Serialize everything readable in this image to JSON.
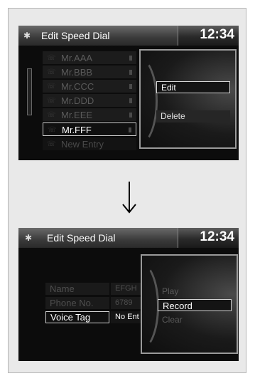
{
  "screen1": {
    "title": "Edit Speed Dial",
    "clock": "12:34",
    "list": [
      {
        "label": "Mr.AAA"
      },
      {
        "label": "Mr.BBB"
      },
      {
        "label": "Mr.CCC"
      },
      {
        "label": "Mr.DDD"
      },
      {
        "label": "Mr.EEE"
      },
      {
        "label": "Mr.FFF",
        "selected": true
      },
      {
        "label": "New Entry"
      }
    ],
    "menu": [
      {
        "label": "Edit",
        "selected": true
      },
      {
        "label": "Delete",
        "selected": false
      }
    ]
  },
  "arrow": "down-arrow",
  "screen2": {
    "title": "Edit Speed Dial",
    "clock": "12:34",
    "fields": [
      {
        "label": "Name",
        "value": "EFGH"
      },
      {
        "label": "Phone No.",
        "value": "6789"
      },
      {
        "label": "Voice Tag",
        "value": "No Ent",
        "active": true
      }
    ],
    "menu": [
      {
        "label": "Play",
        "selected": false
      },
      {
        "label": "Record",
        "selected": true
      },
      {
        "label": "Clear",
        "selected": false
      }
    ]
  }
}
